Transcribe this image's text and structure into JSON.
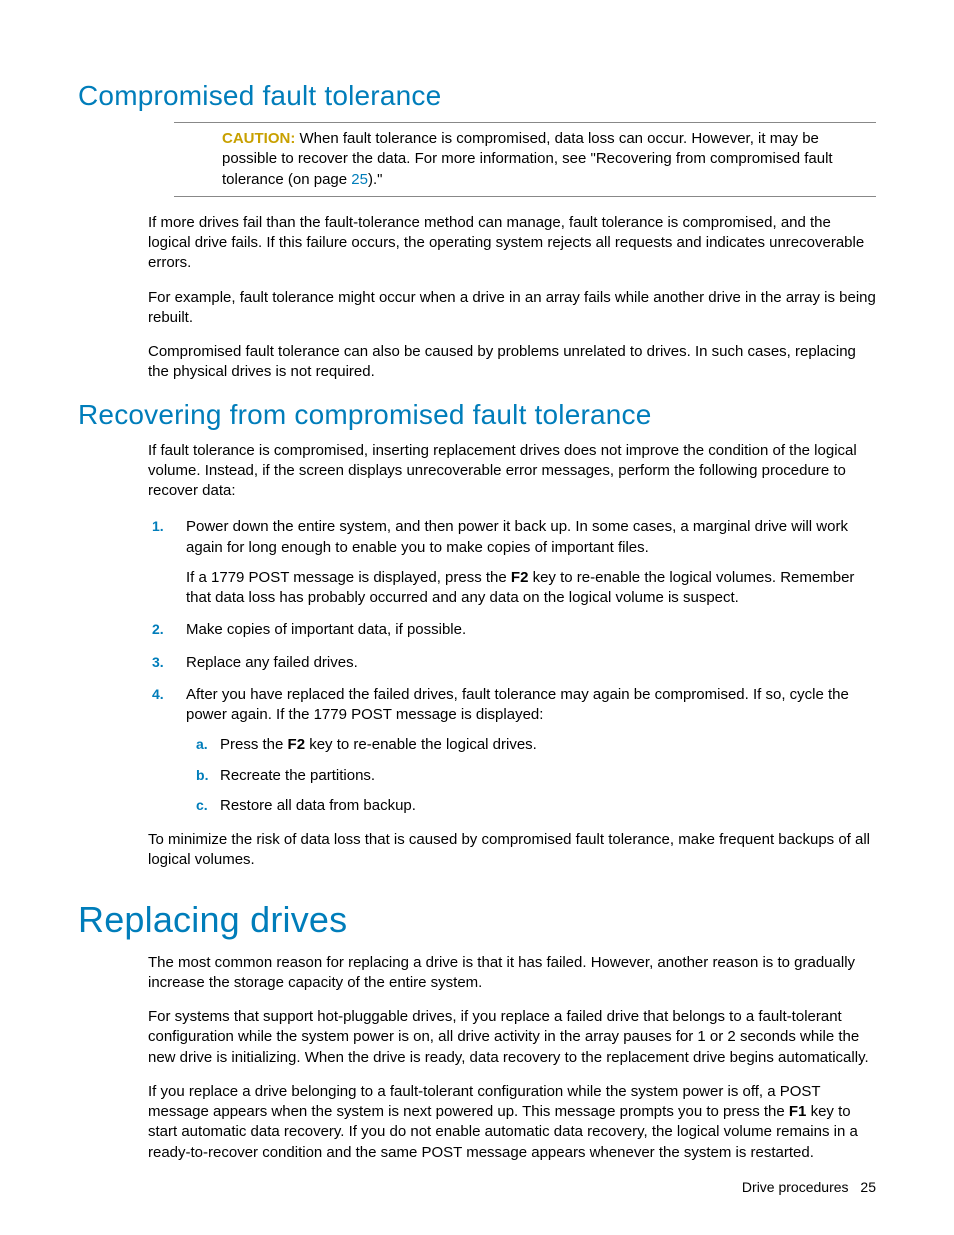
{
  "sec1": {
    "title": "Compromised fault tolerance",
    "caution_label": "CAUTION:",
    "caution_text_a": "When fault tolerance is compromised, data loss can occur. However, it may be possible to recover the data. For more information, see \"Recovering from compromised fault tolerance (on page ",
    "caution_link": "25",
    "caution_text_b": ").\"",
    "p1": "If more drives fail than the fault-tolerance method can manage, fault tolerance is compromised, and the logical drive fails. If this failure occurs, the operating system rejects all requests and indicates unrecoverable errors.",
    "p2": "For example, fault tolerance might occur when a drive in an array fails while another drive in the array is being rebuilt.",
    "p3": "Compromised fault tolerance can also be caused by problems unrelated to drives. In such cases, replacing the physical drives is not required."
  },
  "sec2": {
    "title": "Recovering from compromised fault tolerance",
    "intro": "If fault tolerance is compromised, inserting replacement drives does not improve the condition of the logical volume. Instead, if the screen displays unrecoverable error messages, perform the following procedure to recover data:",
    "step1a": "Power down the entire system, and then power it back up. In some cases, a marginal drive will work again for long enough to enable you to make copies of important files.",
    "step1b_a": "If a 1779 POST message is displayed, press the ",
    "step1b_key": "F2",
    "step1b_b": " key to re-enable the logical volumes. Remember that data loss has probably occurred and any data on the logical volume is suspect.",
    "step2": "Make copies of important data, if possible.",
    "step3": "Replace any failed drives.",
    "step4": "After you have replaced the failed drives, fault tolerance may again be compromised. If so, cycle the power again. If the 1779 POST message is displayed:",
    "step4a_a": "Press the ",
    "step4a_key": "F2",
    "step4a_b": " key to re-enable the logical drives.",
    "step4b": "Recreate the partitions.",
    "step4c": "Restore all data from backup.",
    "closing": "To minimize the risk of data loss that is caused by compromised fault tolerance, make frequent backups of all logical volumes."
  },
  "sec3": {
    "title": "Replacing drives",
    "p1": "The most common reason for replacing a drive is that it has failed. However, another reason is to gradually increase the storage capacity of the entire system.",
    "p2": "For systems that support hot-pluggable drives, if you replace a failed drive that belongs to a fault-tolerant configuration while the system power is on, all drive activity in the array pauses for 1 or 2 seconds while the new drive is initializing. When the drive is ready, data recovery to the replacement drive begins automatically.",
    "p3_a": "If you replace a drive belonging to a fault-tolerant configuration while the system power is off, a POST message appears when the system is next powered up. This message prompts you to press the ",
    "p3_key": "F1",
    "p3_b": " key to start automatic data recovery. If you do not enable automatic data recovery, the logical volume remains in a ready-to-recover condition and the same POST message appears whenever the system is restarted."
  },
  "footer": {
    "label": "Drive procedures",
    "page": "25"
  }
}
